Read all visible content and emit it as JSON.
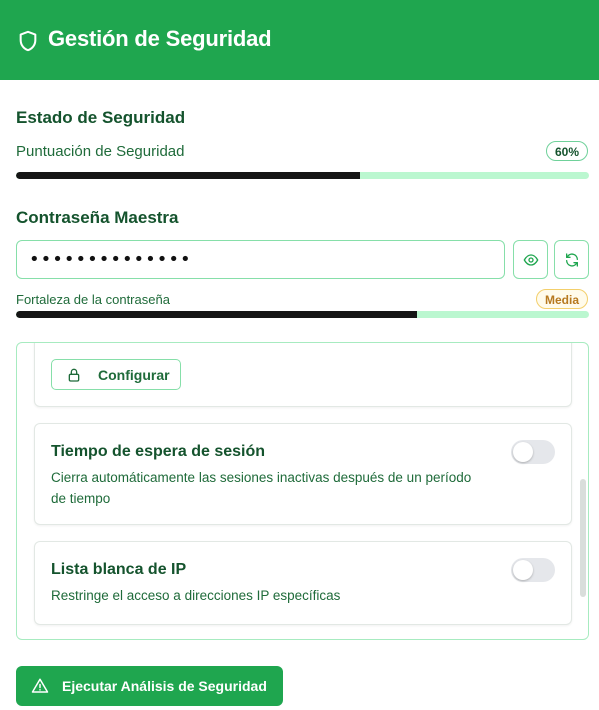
{
  "header": {
    "title": "Gestión de Seguridad",
    "icon": "shield-icon"
  },
  "status": {
    "heading": "Estado de Seguridad",
    "score_label": "Puntuación de Seguridad",
    "score_badge": "60%",
    "score_value": 0.6
  },
  "master_password": {
    "heading": "Contraseña Maestra",
    "value": "••••••••••••••",
    "show_icon": "eye-icon",
    "regenerate_icon": "refresh-icon",
    "strength_label": "Fortaleza de la contraseña",
    "strength_badge": "Media",
    "strength_value": 0.7
  },
  "settings": {
    "configure_label": "Configurar",
    "configure_icon": "lock-icon",
    "items": [
      {
        "title": "Tiempo de espera de sesión",
        "description_line1": "Cierra automáticamente las sesiones inactivas después de un período",
        "description_line2": "de tiempo",
        "enabled": false
      },
      {
        "title": "Lista blanca de IP",
        "description_line1": "Restringe el acceso a direcciones IP específicas",
        "enabled": false
      }
    ]
  },
  "actions": {
    "scan_label": "Ejecutar Análisis de Seguridad",
    "scan_icon": "warning-icon"
  },
  "colors": {
    "primary": "#1fa64f",
    "text": "#14532d",
    "track": "#bbf7d0",
    "warning_badge": "#b7791f"
  }
}
